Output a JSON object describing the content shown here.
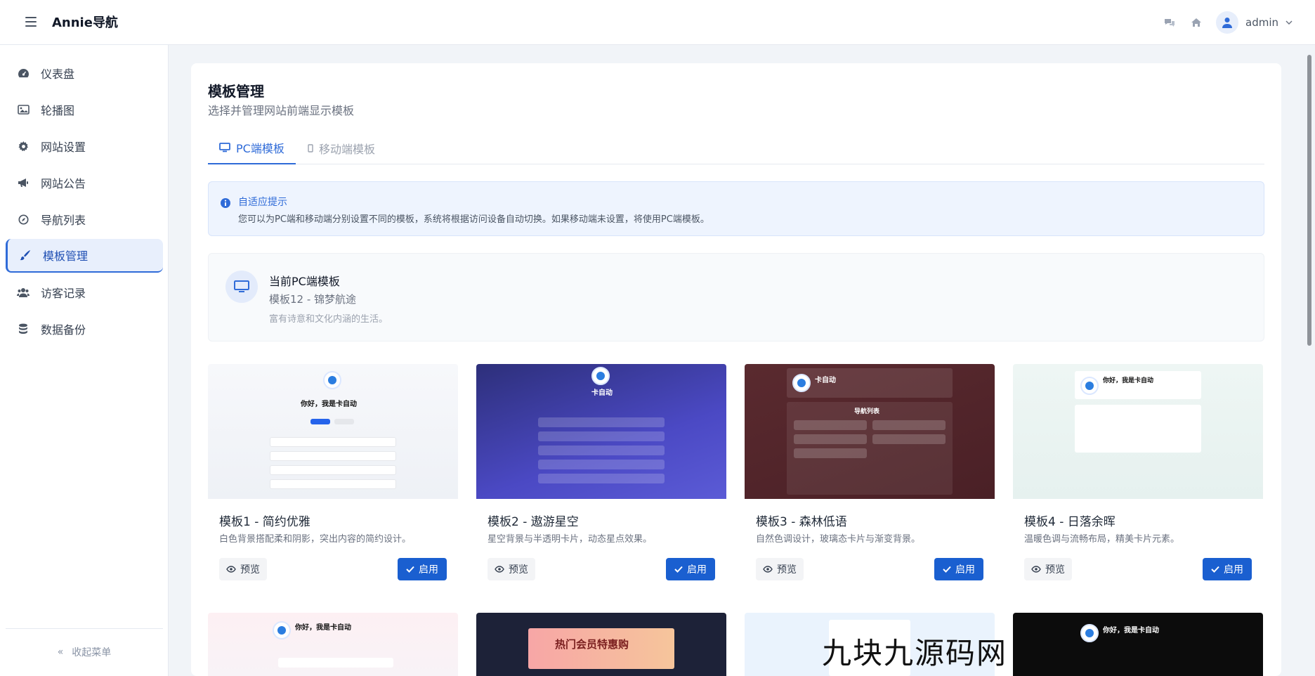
{
  "header": {
    "brand": "Annie导航",
    "username": "admin",
    "icons": [
      "menu-icon",
      "chat-icon",
      "home-icon",
      "user-icon",
      "chevron-down-icon"
    ]
  },
  "sidebar": {
    "items": [
      {
        "label": "仪表盘",
        "icon": "dashboard-icon"
      },
      {
        "label": "轮播图",
        "icon": "image-icon"
      },
      {
        "label": "网站设置",
        "icon": "gear-icon"
      },
      {
        "label": "网站公告",
        "icon": "megaphone-icon"
      },
      {
        "label": "导航列表",
        "icon": "compass-icon"
      },
      {
        "label": "模板管理",
        "icon": "brush-icon",
        "active": true
      },
      {
        "label": "访客记录",
        "icon": "users-icon"
      },
      {
        "label": "数据备份",
        "icon": "database-icon"
      }
    ],
    "collapse_label": "收起菜单"
  },
  "page": {
    "title": "模板管理",
    "subtitle": "选择并管理网站前端显示模板"
  },
  "tabs": [
    {
      "label": "PC端模板",
      "active": true,
      "icon": "desktop-icon"
    },
    {
      "label": "移动端模板",
      "active": false,
      "icon": "mobile-icon"
    }
  ],
  "notice": {
    "title": "自适应提示",
    "text": "您可以为PC端和移动端分别设置不同的模板，系统将根据访问设备自动切换。如果移动端未设置，将使用PC端模板。"
  },
  "current": {
    "label": "当前PC端模板",
    "name": "模板12 - 锦梦航途",
    "desc": "富有诗意和文化内涵的生活。"
  },
  "templates": [
    {
      "name": "模板1 - 简约优雅",
      "desc": "白色背景搭配柔和阴影，突出内容的简约设计。",
      "preview": "预览",
      "enable": "启用"
    },
    {
      "name": "模板2 - 遨游星空",
      "desc": "星空背景与半透明卡片，动态星点效果。",
      "preview": "预览",
      "enable": "启用"
    },
    {
      "name": "模板3 - 森林低语",
      "desc": "自然色调设计，玻璃态卡片与渐变背景。",
      "preview": "预览",
      "enable": "启用"
    },
    {
      "name": "模板4 - 日落余晖",
      "desc": "温暖色调与流畅布局，精美卡片元素。",
      "preview": "预览",
      "enable": "启用"
    }
  ],
  "thumb_text": {
    "greeting": "你好，我是卡自动",
    "site": "卡自动",
    "nav_list": "导航列表",
    "promo": "热门会员特惠购"
  },
  "colors": {
    "accent": "#2f6bd8",
    "button": "#1a5fd0",
    "sidebar_active_bg": "#e8effc"
  },
  "watermark": "九块九源码网"
}
